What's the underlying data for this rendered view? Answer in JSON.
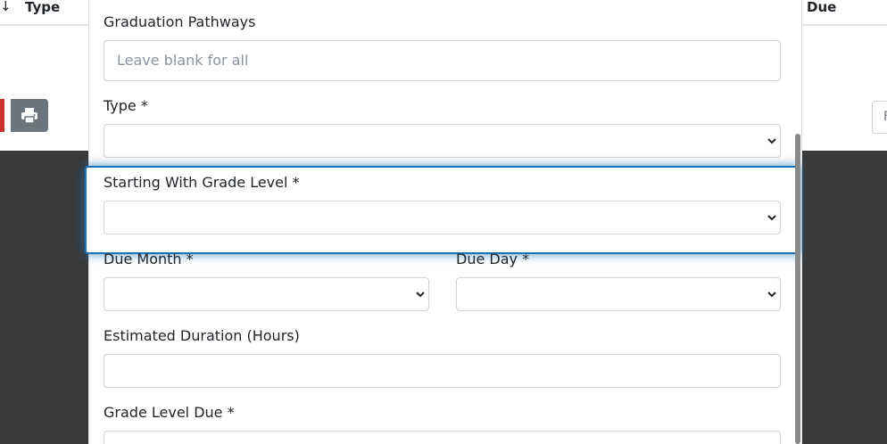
{
  "background": {
    "sort_arrow": "↓",
    "columns": {
      "type": "Type",
      "due": "Due"
    },
    "page_input_text": "F"
  },
  "form": {
    "graduation_pathways": {
      "label": "Graduation Pathways",
      "placeholder": "Leave blank for all",
      "value": ""
    },
    "type": {
      "label": "Type *",
      "value": ""
    },
    "starting_grade_level": {
      "label": "Starting With Grade Level *",
      "value": ""
    },
    "due_month": {
      "label": "Due Month *",
      "value": ""
    },
    "due_day": {
      "label": "Due Day *",
      "value": ""
    },
    "estimated_duration": {
      "label": "Estimated Duration (Hours)",
      "value": ""
    },
    "grade_level_due": {
      "label": "Grade Level Due *",
      "value": ""
    }
  },
  "colors": {
    "focus": "#1a73b8",
    "overlay": "#3a3a3a",
    "print_button": "#6c757d"
  },
  "icons": {
    "print": "print-icon",
    "select_arrow": "chevron-down-icon"
  }
}
